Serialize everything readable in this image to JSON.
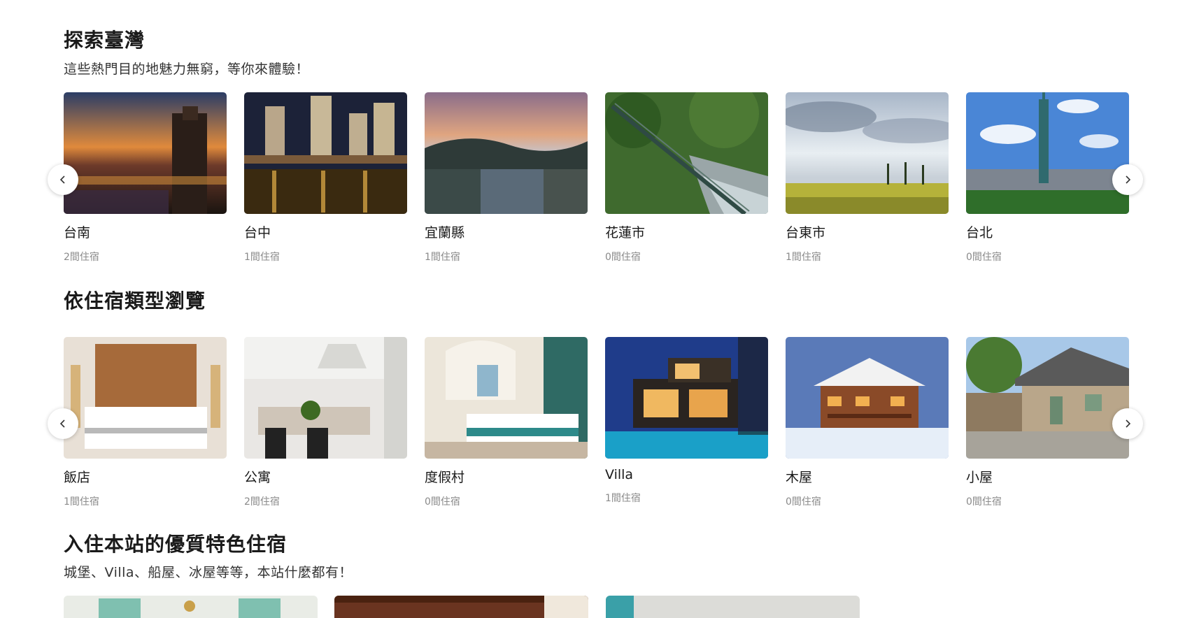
{
  "explore": {
    "title": "探索臺灣",
    "subtitle": "這些熱門目的地魅力無窮，等你來體驗！",
    "items": [
      {
        "name": "台南",
        "count": "2間住宿"
      },
      {
        "name": "台中",
        "count": "1間住宿"
      },
      {
        "name": "宜蘭縣",
        "count": "1間住宿"
      },
      {
        "name": "花蓮市",
        "count": "0間住宿"
      },
      {
        "name": "台東市",
        "count": "1間住宿"
      },
      {
        "name": "台北",
        "count": "0間住宿"
      }
    ]
  },
  "types": {
    "title": "依住宿類型瀏覽",
    "items": [
      {
        "name": "飯店",
        "count": "1間住宿"
      },
      {
        "name": "公寓",
        "count": "2間住宿"
      },
      {
        "name": "度假村",
        "count": "0間住宿"
      },
      {
        "name": "Villa",
        "count": "1間住宿"
      },
      {
        "name": "木屋",
        "count": "0間住宿"
      },
      {
        "name": "小屋",
        "count": "0間住宿"
      }
    ]
  },
  "featured": {
    "title": "入住本站的優質特色住宿",
    "subtitle": "城堡、Villa、船屋、冰屋等等，本站什麼都有！"
  },
  "icons": {
    "prev": "chevron-left-icon",
    "next": "chevron-right-icon"
  }
}
